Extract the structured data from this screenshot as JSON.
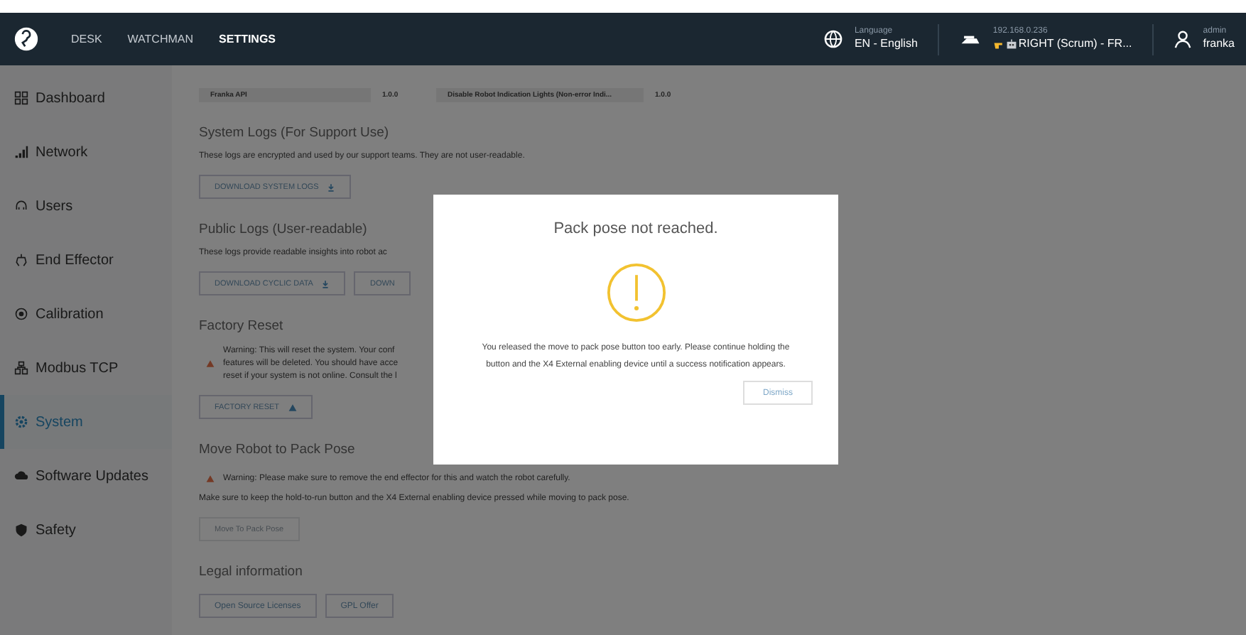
{
  "nav": {
    "tabs": [
      {
        "label": "DESK",
        "selected": false
      },
      {
        "label": "WATCHMAN",
        "selected": false
      },
      {
        "label": "SETTINGS",
        "selected": true
      }
    ],
    "language": {
      "label": "Language",
      "value": "EN - English"
    },
    "robot": {
      "address": "192.168.0.236",
      "name": "RIGHT (Scrum) - FR..."
    },
    "user": {
      "role": "admin",
      "name": "franka"
    }
  },
  "sidebar": {
    "items": [
      {
        "label": "Dashboard",
        "selected": false
      },
      {
        "label": "Network",
        "selected": false
      },
      {
        "label": "Users",
        "selected": false
      },
      {
        "label": "End Effector",
        "selected": false
      },
      {
        "label": "Calibration",
        "selected": false
      },
      {
        "label": "Modbus TCP",
        "selected": false
      },
      {
        "label": "System",
        "selected": true
      },
      {
        "label": "Software Updates",
        "selected": false
      },
      {
        "label": "Safety",
        "selected": false
      }
    ]
  },
  "version_row": [
    "Franka API",
    "1.0.0",
    "Disable Robot Indication Lights (Non-error Indi...",
    "1.0.0"
  ],
  "system_logs": {
    "heading": "System Logs (For Support Use)",
    "description": "These logs are encrypted and used by our support teams. They are not user-readable.",
    "buttons": [
      {
        "label": "DOWNLOAD SYSTEM LOGS"
      }
    ]
  },
  "public_logs": {
    "heading": "Public Logs (User-readable)",
    "description": "These logs provide readable insights into robot ac",
    "buttons": [
      {
        "label": "DOWNLOAD CYCLIC DATA"
      },
      {
        "label": "DOWN"
      }
    ]
  },
  "factory_reset": {
    "heading": "Factory Reset",
    "warning_lines": [
      "Warning: This will reset the system. Your conf",
      "features will be deleted. You should have acce",
      "reset if your system is not online. Consult the l"
    ],
    "button": {
      "label": "FACTORY RESET"
    }
  },
  "pack_pose": {
    "heading": "Move Robot to Pack Pose",
    "warning": "Warning: Please make sure to remove the end effector for this and watch the robot carefully.",
    "description": "Make sure to keep the hold-to-run button and the X4 External enabling device pressed while moving to pack pose.",
    "button": {
      "label": "Move To Pack Pose",
      "disabled": true
    }
  },
  "legal": {
    "heading": "Legal information",
    "buttons": [
      {
        "label": "Open Source Licenses"
      },
      {
        "label": "GPL Offer"
      }
    ]
  },
  "dialog": {
    "title": "Pack pose not reached.",
    "message": "You released the move to pack pose button too early. Please continue holding the button and the X4 External enabling device until a success notification appears.",
    "button": "Dismiss"
  }
}
